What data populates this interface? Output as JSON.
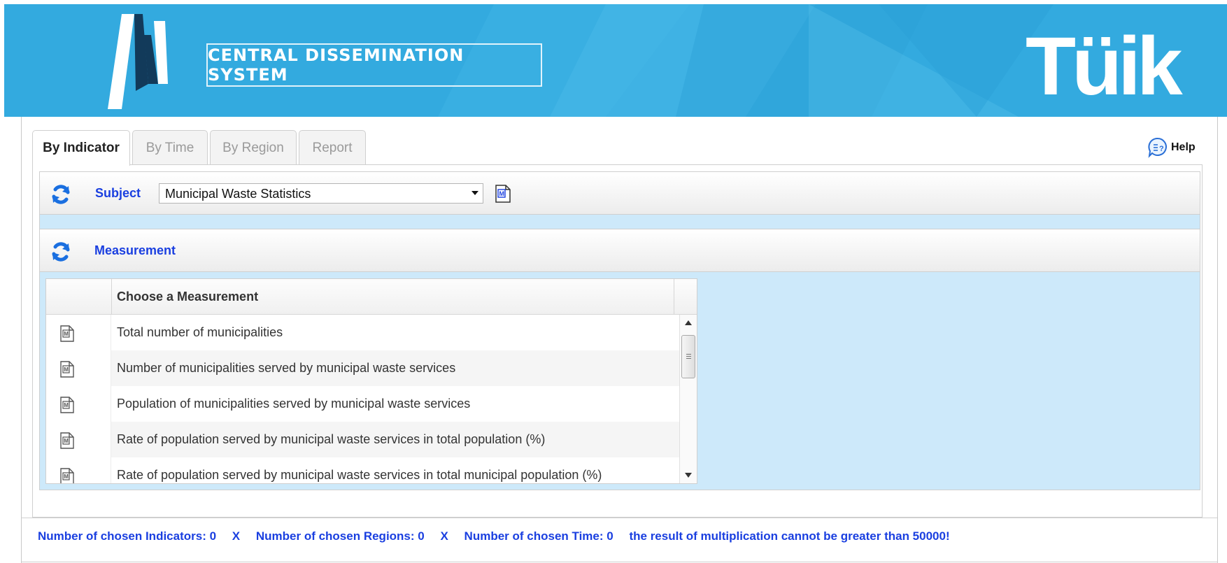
{
  "header": {
    "system_title": "CENTRAL DISSEMINATION SYSTEM",
    "logo_right_text": "Tüik",
    "background_color": "#33aadf"
  },
  "tabs": [
    {
      "label": "By Indicator",
      "active": true
    },
    {
      "label": "By Time",
      "active": false
    },
    {
      "label": "By Region",
      "active": false
    },
    {
      "label": "Report",
      "active": false
    }
  ],
  "help": {
    "label": "Help"
  },
  "subject": {
    "label": "Subject",
    "selected": "Municipal Waste Statistics"
  },
  "measurement": {
    "label": "Measurement",
    "column_header": "Choose a Measurement",
    "rows": [
      "Total number of municipalities",
      "Number of municipalities served by municipal waste services",
      "Population of municipalities served by municipal waste services",
      "Rate of population served by municipal waste services in total population (%)",
      "Rate of population served by municipal waste services in total municipal population (%)"
    ]
  },
  "footer": {
    "indicators": "Number of chosen Indicators: 0",
    "x1": "X",
    "regions": "Number of chosen Regions: 0",
    "x2": "X",
    "time": "Number of chosen Time: 0",
    "warning": "the result of multiplication cannot be greater than 50000!"
  },
  "colors": {
    "accent_blue": "#1a3fe0",
    "panel_light_blue": "#cde9fa"
  }
}
